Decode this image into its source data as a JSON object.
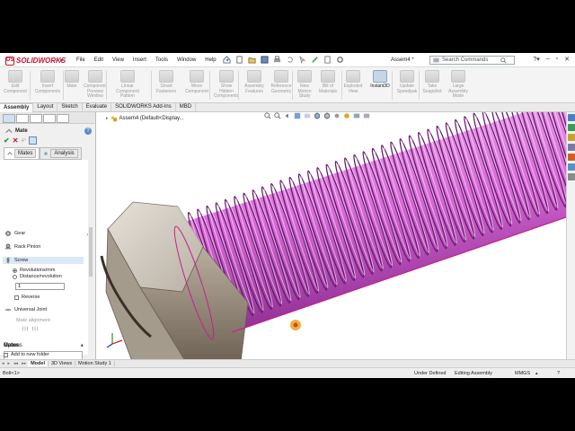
{
  "app": {
    "brand": "SOLIDWORKS",
    "doc_title": "Assem4 *"
  },
  "menu": [
    "File",
    "Edit",
    "View",
    "Insert",
    "Tools",
    "Window",
    "Help"
  ],
  "search": {
    "placeholder": "Search Commands"
  },
  "ribbon": {
    "buttons": [
      {
        "label": "Edit\nComponent",
        "active": false
      },
      {
        "label": "Insert\nComponents",
        "active": false
      },
      {
        "label": "Mate",
        "active": false
      },
      {
        "label": "Component\nPreview\nWindow",
        "active": false
      },
      {
        "label": "Linear Component\nPattern",
        "active": false
      },
      {
        "label": "Smart\nFasteners",
        "active": false
      },
      {
        "label": "Move\nComponent",
        "active": false
      },
      {
        "label": "Show\nHidden\nComponents",
        "active": false
      },
      {
        "label": "Assembly\nFeatures",
        "active": false
      },
      {
        "label": "Reference\nGeometry",
        "active": false
      },
      {
        "label": "New\nMotion\nStudy",
        "active": false
      },
      {
        "label": "Bill of\nMaterials",
        "active": false
      },
      {
        "label": "Exploded\nView",
        "active": false
      },
      {
        "label": "Instant3D",
        "active": true
      },
      {
        "label": "Update\nSpeedpak",
        "active": false
      },
      {
        "label": "Take\nSnapshot",
        "active": false
      },
      {
        "label": "Large\nAssembly\nMode",
        "active": false
      }
    ]
  },
  "command_tabs": [
    {
      "label": "Assembly",
      "active": true
    },
    {
      "label": "Layout",
      "active": false
    },
    {
      "label": "Sketch",
      "active": false
    },
    {
      "label": "Evaluate",
      "active": false
    },
    {
      "label": "SOLIDWORKS Add-Ins",
      "active": false
    },
    {
      "label": "MBD",
      "active": false
    }
  ],
  "property_manager": {
    "title": "Mate",
    "subtabs": [
      "Mates",
      "Analysis"
    ],
    "mechanical": {
      "gear": "Gear",
      "rack_pinion": "Rack Pinion",
      "screw": "Screw",
      "revolutions": "Revolutions/mm",
      "distance": "Distance/revolution",
      "value": "1",
      "reverse": "Reverse",
      "universal_joint": "Universal Joint",
      "mate_alignment": "Mate alignment:"
    },
    "mates_group": "Mates",
    "options_group": "Options",
    "add_to_folder": "Add to new folder"
  },
  "tree": {
    "root": "Assem4 (Default<Display..."
  },
  "bottom_tabs": [
    {
      "label": "Model",
      "active": true
    },
    {
      "label": "3D Views",
      "active": false
    },
    {
      "label": "Motion Study 1",
      "active": false
    }
  ],
  "status": {
    "selection": "Bolt<1>",
    "definition": "Under Defined",
    "mode": "Editing Assembly",
    "units": "MMGS"
  },
  "colors": {
    "thread": "#d86ad8",
    "thread_edge": "#6a1870",
    "mate_highlight": "#c7208a",
    "head": "#c9c2b8",
    "brand": "#c8102e"
  }
}
